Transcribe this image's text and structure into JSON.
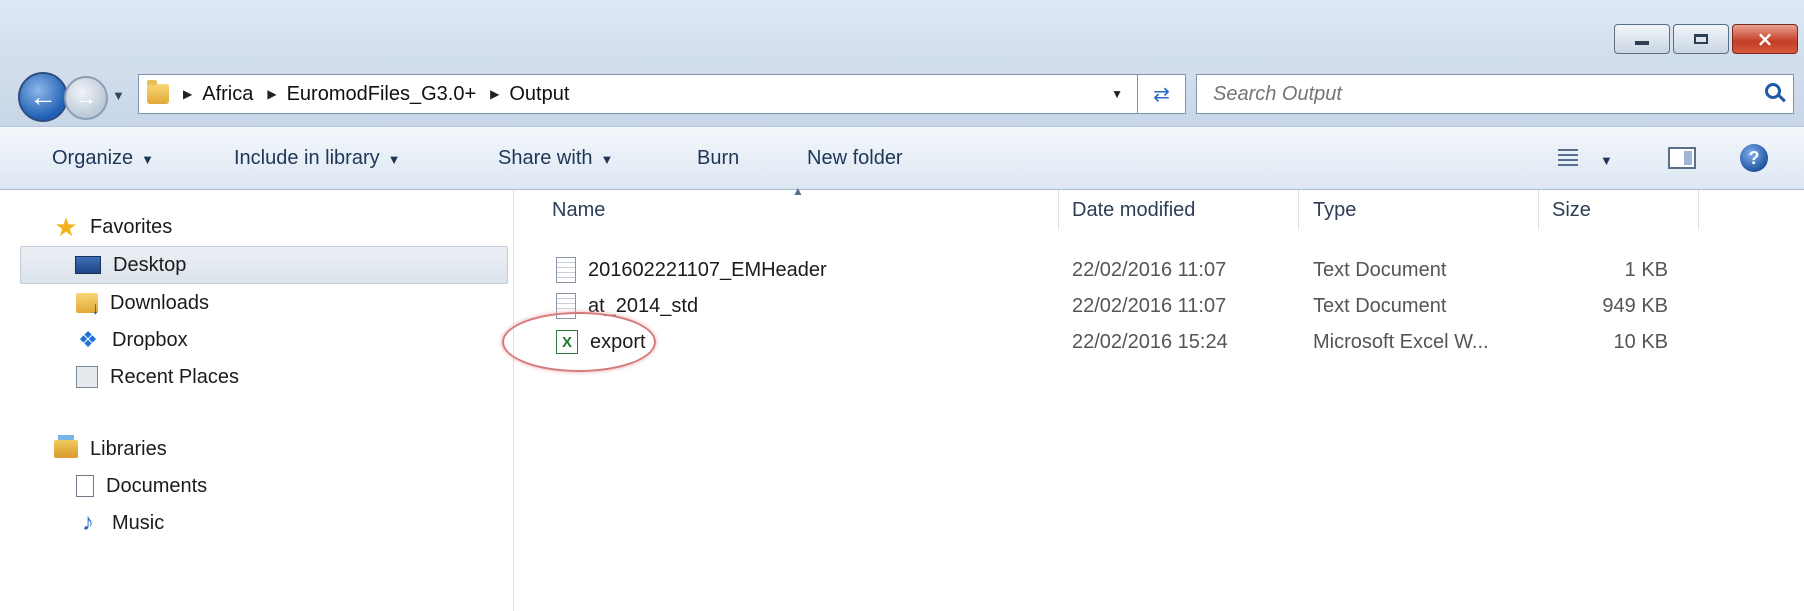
{
  "window": {
    "controls": {
      "minimize": "minimize",
      "maximize": "maximize",
      "close": "×"
    }
  },
  "address": {
    "crumbs": [
      "Africa",
      "EuromodFiles_G3.0+",
      "Output"
    ]
  },
  "search": {
    "placeholder": "Search Output"
  },
  "toolbar": {
    "organize": "Organize",
    "include_in_library": "Include in library",
    "share_with": "Share with",
    "burn": "Burn",
    "new_folder": "New folder"
  },
  "sidebar": {
    "favorites": {
      "header": "Favorites",
      "items": [
        "Desktop",
        "Downloads",
        "Dropbox",
        "Recent Places"
      ]
    },
    "libraries": {
      "header": "Libraries",
      "items": [
        "Documents",
        "Music"
      ]
    }
  },
  "filelist": {
    "columns": {
      "name": "Name",
      "date": "Date modified",
      "type": "Type",
      "size": "Size"
    },
    "rows": [
      {
        "name": "201602221107_EMHeader",
        "date": "22/02/2016 11:07",
        "type": "Text Document",
        "size": "1 KB",
        "icon": "text-file-icon"
      },
      {
        "name": "at_2014_std",
        "date": "22/02/2016 11:07",
        "type": "Text Document",
        "size": "949 KB",
        "icon": "text-file-icon"
      },
      {
        "name": "export",
        "date": "22/02/2016 15:24",
        "type": "Microsoft Excel W...",
        "size": "10 KB",
        "icon": "excel-file-icon"
      }
    ]
  },
  "colors": {
    "annotation": "#d67b7b",
    "selection": "#dbe3ec",
    "accent": "#1f5fb4"
  }
}
